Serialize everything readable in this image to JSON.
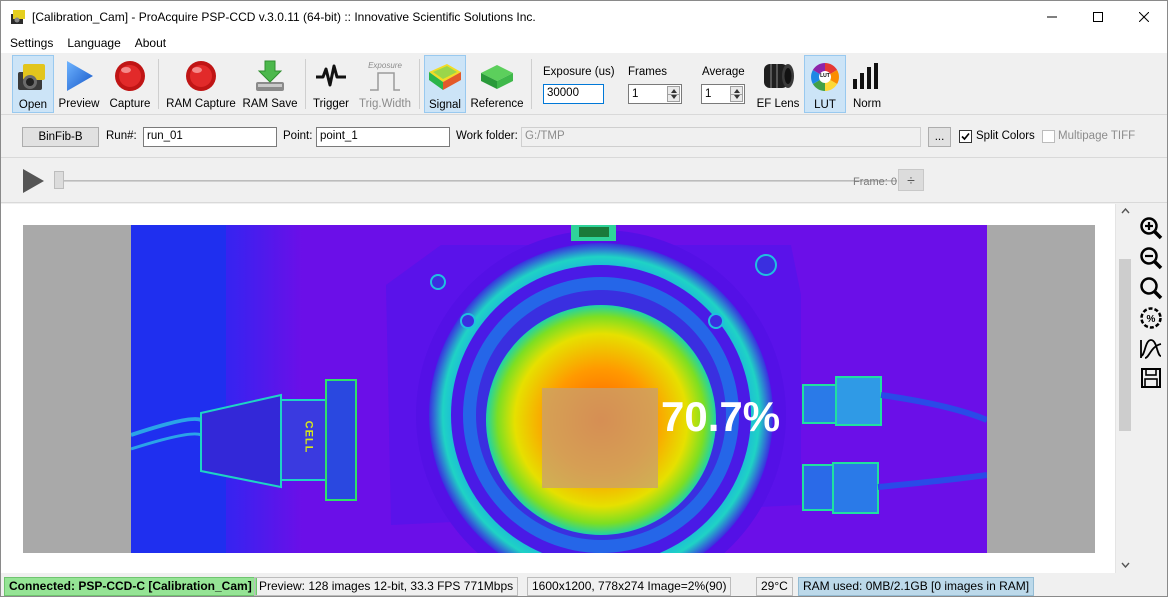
{
  "window": {
    "title": "[Calibration_Cam] - ProAcquire PSP-CCD v.3.0.11 (64-bit)  ::  Innovative Scientific Solutions Inc."
  },
  "menu": [
    "Settings",
    "Language",
    "About"
  ],
  "toolbar": {
    "open": "Open",
    "preview": "Preview",
    "capture": "Capture",
    "ram_capture": "RAM Capture",
    "ram_save": "RAM Save",
    "trigger": "Trigger",
    "trig_width": "Trig.Width",
    "trig_width_icon_text": "Exposure",
    "signal": "Signal",
    "reference": "Reference",
    "exposure_label": "Exposure (us)",
    "exposure_value": "30000",
    "frames_label": "Frames",
    "frames_value": "1",
    "average_label": "Average",
    "average_value": "1",
    "ef_lens": "EF Lens",
    "lut": "LUT",
    "lut_icon_text": "LUT",
    "norm": "Norm"
  },
  "run_bar": {
    "binfib_button": "BinFib-B",
    "run_label": "Run#:",
    "run_value": "run_01",
    "point_label": "Point:",
    "point_value": "point_1",
    "workfolder_label": "Work folder:",
    "workfolder_value": "G:/TMP",
    "browse_button": "...",
    "split_colors_label": "Split Colors",
    "split_colors_checked": true,
    "multipage_label": "Multipage TIFF",
    "multipage_checked": false
  },
  "player": {
    "frame_label": "Frame: 0",
    "frame_button": "÷"
  },
  "viewer": {
    "overlay_percent": "70.7%",
    "connector_label": "CELL"
  },
  "status": {
    "connected": "Connected: PSP-CCD-C [Calibration_Cam]",
    "preview": "Preview: 128 images 12-bit, 33.3 FPS 771Mbps",
    "resolution": "1600x1200, 778x274  Image=2%(90)",
    "temperature": "29°C",
    "ram": "RAM used: 0MB/2.1GB [0 images in RAM]"
  },
  "colors": {
    "status_connected": "#95e495",
    "status_ram": "#bcd9ea",
    "active_tool": "#cce4f7",
    "image_background": "#a9a9a9"
  }
}
